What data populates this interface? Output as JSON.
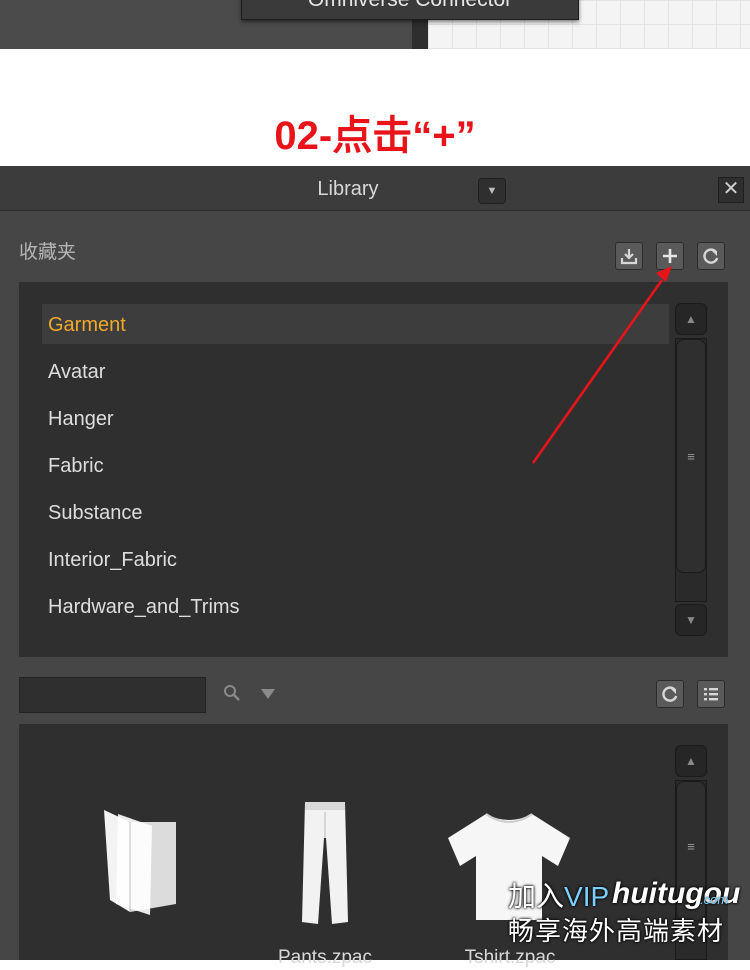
{
  "top_fragment": {
    "menu_text": "Omniverse Connector"
  },
  "step_title": "02-点击“+”",
  "library": {
    "title": "Library",
    "close_symbol": "✕",
    "dropdown_symbol": "▼",
    "favorites": {
      "label": "收藏夹",
      "items": [
        {
          "label": "Garment",
          "selected": true
        },
        {
          "label": "Avatar",
          "selected": false
        },
        {
          "label": "Hanger",
          "selected": false
        },
        {
          "label": "Fabric",
          "selected": false
        },
        {
          "label": "Substance",
          "selected": false
        },
        {
          "label": "Interior_Fabric",
          "selected": false
        },
        {
          "label": "Hardware_and_Trims",
          "selected": false
        }
      ],
      "toolbar_icons": [
        "export-icon",
        "plus-icon",
        "refresh-icon"
      ]
    },
    "search": {
      "value": "",
      "placeholder": ""
    },
    "grid_items": [
      {
        "label": "",
        "icon": "folder-icon"
      },
      {
        "label": "Pants.zpac",
        "icon": "pants-thumbnail"
      },
      {
        "label": "Tshirt.zpac",
        "icon": "tshirt-thumbnail"
      }
    ]
  },
  "watermark": {
    "prefix": "加入",
    "vip": "VIP",
    "brand": "huitugou",
    "domain": ".com",
    "slogan": "畅享海外高端素材"
  },
  "colors": {
    "accent_selected": "#f1a92a",
    "annotation_red": "#e8141a",
    "panel_bg": "#464646",
    "list_bg": "#2f2f2f"
  }
}
